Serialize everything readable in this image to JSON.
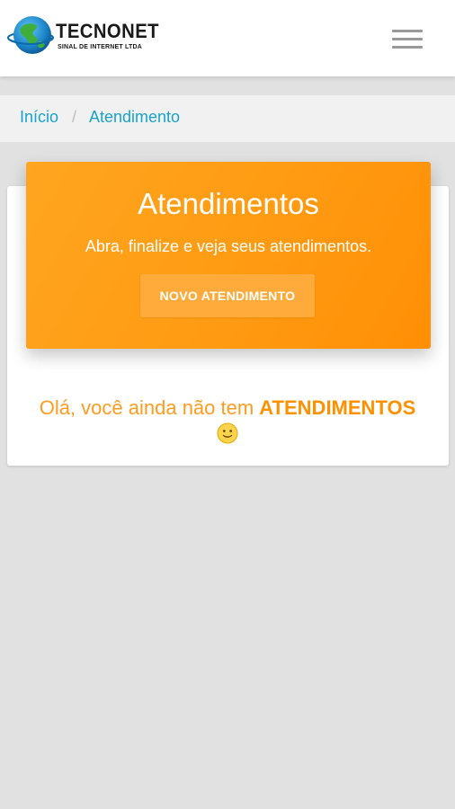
{
  "header": {
    "brand_name": "TECNONET",
    "brand_tagline": "SINAL DE INTERNET LTDA",
    "logo_icon": "globe-icon",
    "menu_icon": "hamburger-menu-icon"
  },
  "breadcrumb": {
    "items": [
      {
        "label": "Início"
      },
      {
        "label": "Atendimento"
      }
    ],
    "separator": "/"
  },
  "hero": {
    "title": "Atendimentos",
    "subtitle": "Abra, finalize e veja seus atendimentos.",
    "button_label": "NOVO ATENDIMENTO"
  },
  "empty_state": {
    "text": "Olá, você ainda não tem ",
    "highlight": "ATENDIMENTOS",
    "icon": "slightly-smiling-face-icon"
  },
  "colors": {
    "accent_orange": "#ff9c14",
    "link_blue": "#1aa3c8",
    "background": "#e1e1e1"
  }
}
